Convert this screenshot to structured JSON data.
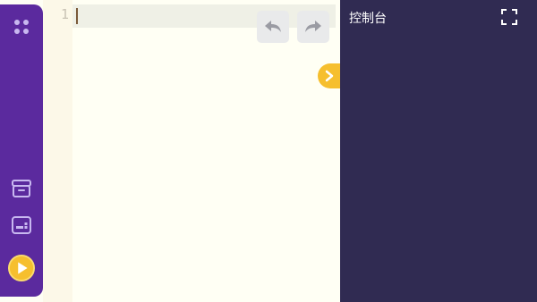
{
  "editor": {
    "line_numbers": [
      "1"
    ],
    "code": ""
  },
  "toolbar": {
    "undo_icon": "undo-icon",
    "redo_icon": "redo-icon",
    "toggle_icon": "chevron-right-icon"
  },
  "sidebar": {
    "items": [
      {
        "icon": "apps-grid-icon"
      },
      {
        "icon": "box-icon"
      },
      {
        "icon": "keyboard-icon"
      },
      {
        "icon": "play-icon"
      }
    ]
  },
  "console": {
    "title": "控制台",
    "fullscreen_icon": "fullscreen-icon"
  },
  "colors": {
    "sidebar": "#5b2a9e",
    "console": "#302b52",
    "accent": "#f6bf2e",
    "editor_bg": "#fffff4"
  }
}
